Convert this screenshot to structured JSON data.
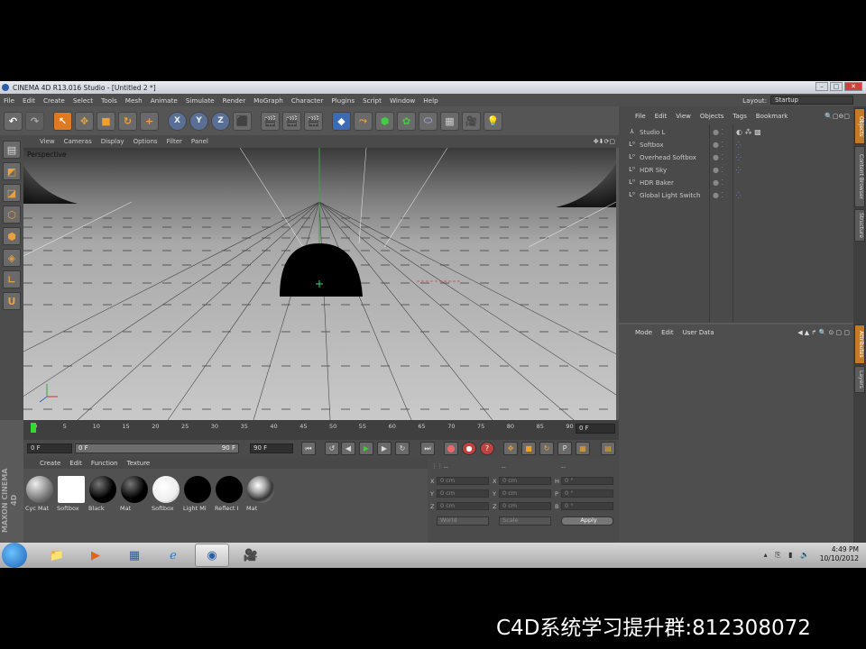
{
  "window": {
    "title": "CINEMA 4D R13.016 Studio - [Untitled 2 *]"
  },
  "menu": [
    "File",
    "Edit",
    "Create",
    "Select",
    "Tools",
    "Mesh",
    "Animate",
    "Simulate",
    "Render",
    "MoGraph",
    "Character",
    "Plugins",
    "Script",
    "Window",
    "Help"
  ],
  "layout": {
    "label": "Layout:",
    "value": "Startup"
  },
  "viewport": {
    "menu": [
      "View",
      "Cameras",
      "Display",
      "Options",
      "Filter",
      "Panel"
    ],
    "label": "Perspective"
  },
  "timeline": {
    "ticks": [
      "0",
      "5",
      "10",
      "15",
      "20",
      "25",
      "30",
      "35",
      "40",
      "45",
      "50",
      "55",
      "60",
      "65",
      "70",
      "75",
      "80",
      "85",
      "90"
    ],
    "current_frame": "0 F"
  },
  "playback": {
    "start": "0 F",
    "slider_left": "0 F",
    "slider_right": "90 F",
    "end": "90 F"
  },
  "materials": {
    "menu": [
      "Create",
      "Edit",
      "Function",
      "Texture"
    ],
    "items": [
      {
        "name": "Cyc Mat",
        "style": "gray"
      },
      {
        "name": "Softbox",
        "style": "white"
      },
      {
        "name": "Black",
        "style": "black"
      },
      {
        "name": "Mat",
        "style": "black"
      },
      {
        "name": "Softbox",
        "style": "whitesphere"
      },
      {
        "name": "Light Mi",
        "style": "black"
      },
      {
        "name": "Reflect I",
        "style": "black"
      },
      {
        "name": "Mat",
        "style": "chrome"
      }
    ]
  },
  "coords": {
    "header": [
      "--",
      "--",
      "--"
    ],
    "rows": [
      {
        "a": "X",
        "av": "0 cm",
        "b": "X",
        "bv": "0 cm",
        "c": "H",
        "cv": "0 °"
      },
      {
        "a": "Y",
        "av": "0 cm",
        "b": "Y",
        "bv": "0 cm",
        "c": "P",
        "cv": "0 °"
      },
      {
        "a": "Z",
        "av": "0 cm",
        "b": "Z",
        "bv": "0 cm",
        "c": "B",
        "cv": "0 °"
      }
    ],
    "mode1": "World",
    "mode2": "Scale",
    "apply": "Apply"
  },
  "objects": {
    "menu": [
      "File",
      "Edit",
      "View",
      "Objects",
      "Tags",
      "Bookmark"
    ],
    "items": [
      "Studio L",
      "Softbox",
      "Overhead Softbox",
      "HDR Sky",
      "HDR Baker",
      "Global Light Switch"
    ]
  },
  "attributes": {
    "menu": [
      "Mode",
      "Edit",
      "User Data"
    ]
  },
  "right_tabs": [
    "Objects",
    "Content Browser",
    "Structure",
    "Attributes",
    "Layers"
  ],
  "taskbar": {
    "time": "4:49 PM",
    "date": "10/10/2012"
  },
  "watermark": "C4D系统学习提升群:812308072",
  "colors": {
    "accent": "#e07a20",
    "panel": "#4a4a4a"
  }
}
